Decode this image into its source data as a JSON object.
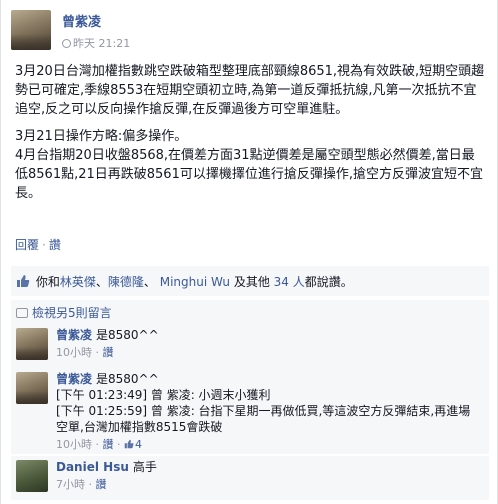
{
  "post": {
    "author": "曾紫凌",
    "time": "昨天 21:21",
    "paragraphs": [
      "3月20日台灣加權指數跳空跌破箱型整理底部頸線8651,視為有效跌破,短期空頭趨勢已可確定,季線8553在短期空頭初立時,為第一道反彈抵抗線,凡第一次抵抗不宜追空,反之可以反向操作搶反彈,在反彈過後方可空單進駐。",
      "3月21日操作方略:偏多操作。\n4月台指期20日收盤8568,在價差方面31點逆價差是屬空頭型態必然價差,當日最低8561點,21日再跌破8561可以擇機擇位進行搶反彈操作,搶空方反彈波宜短不宜長。"
    ],
    "actions": {
      "comment": "回覆",
      "like": "讚"
    }
  },
  "likes": {
    "prefix": "你和",
    "names": [
      "林英傑",
      "陳德隆",
      "Minghui Wu"
    ],
    "separator": "、",
    "and_others_prefix": " 及其他 ",
    "others_count": "34 人",
    "suffix": "都說讚。"
  },
  "view_more": "檢視另5則留言",
  "comments": [
    {
      "author": "曾紫凌",
      "text": "是8580^^",
      "time": "10小時",
      "action": "讚",
      "likes": ""
    },
    {
      "author": "曾紫凌",
      "text": "是8580^^\n[下午 01:23:49] 曾 紫凌: 小週末小獲利\n[下午 01:25:59] 曾 紫凌: 台指下星期一再做低買,等這波空方反彈結束,再進場空單,台灣加權指數8515會跌破",
      "time": "10小時",
      "action": "讚",
      "likes": "4"
    },
    {
      "author": "Daniel Hsu",
      "text": "高手",
      "time": "7小時",
      "action": "讚",
      "likes": ""
    }
  ],
  "colors": {
    "link": "#3b5998",
    "meta": "#9197a3",
    "ufi_bg": "#f6f7f8"
  }
}
